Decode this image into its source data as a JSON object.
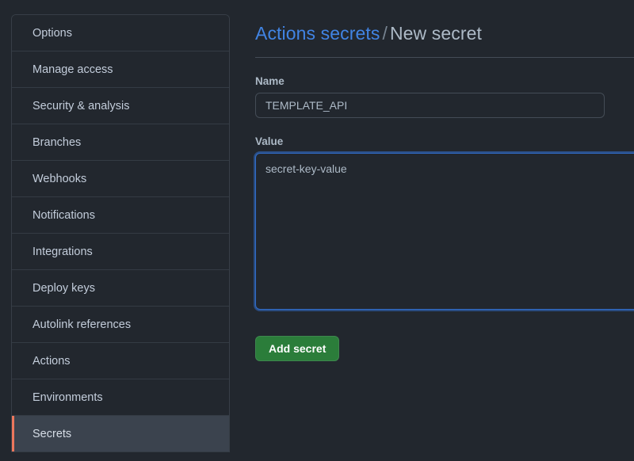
{
  "sidebar": {
    "items": [
      {
        "label": "Options",
        "selected": false
      },
      {
        "label": "Manage access",
        "selected": false
      },
      {
        "label": "Security & analysis",
        "selected": false
      },
      {
        "label": "Branches",
        "selected": false
      },
      {
        "label": "Webhooks",
        "selected": false
      },
      {
        "label": "Notifications",
        "selected": false
      },
      {
        "label": "Integrations",
        "selected": false
      },
      {
        "label": "Deploy keys",
        "selected": false
      },
      {
        "label": "Autolink references",
        "selected": false
      },
      {
        "label": "Actions",
        "selected": false
      },
      {
        "label": "Environments",
        "selected": false
      },
      {
        "label": "Secrets",
        "selected": true
      }
    ],
    "selected_accent_color": "#ec775c"
  },
  "main": {
    "title": {
      "link_text": "Actions secrets",
      "separator": "/",
      "current_text": "New secret",
      "link_color": "#4184e4"
    },
    "name_field": {
      "label": "Name",
      "value": "TEMPLATE_API",
      "placeholder": ""
    },
    "value_field": {
      "label": "Value",
      "value": "secret-key-value",
      "placeholder": "",
      "focused": true,
      "focus_color": "#316dca"
    },
    "submit_button": {
      "label": "Add secret",
      "color": "#2b7d3a"
    }
  }
}
